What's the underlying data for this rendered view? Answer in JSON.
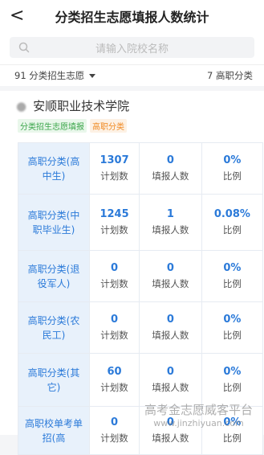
{
  "header": {
    "title": "分类招生志愿填报人数统计",
    "back_glyph": "<"
  },
  "search": {
    "placeholder": "请输入院校名称"
  },
  "filters": {
    "left": "91 分类招生志愿",
    "right": "7 高职分类"
  },
  "school": {
    "name": "安顺职业技术学院",
    "tags": [
      "分类招生志愿填报",
      "高职分类"
    ]
  },
  "columns": [
    "计划数",
    "填报人数",
    "比例"
  ],
  "rows": [
    {
      "label": "高职分类(高中生)",
      "plan": "1307",
      "applied": "0",
      "ratio": "0%"
    },
    {
      "label": "高职分类(中职毕业生)",
      "plan": "1245",
      "applied": "1",
      "ratio": "0.08%"
    },
    {
      "label": "高职分类(退役军人)",
      "plan": "0",
      "applied": "0",
      "ratio": "0%"
    },
    {
      "label": "高职分类(农民工)",
      "plan": "0",
      "applied": "0",
      "ratio": "0%"
    },
    {
      "label": "高职分类(其它)",
      "plan": "60",
      "applied": "0",
      "ratio": "0%"
    },
    {
      "label": "高职校单考单招(高",
      "plan": "0",
      "applied": "0",
      "ratio": "0%"
    }
  ],
  "watermark": {
    "line1": "高考金志愿威客平台",
    "line2": "www.jinzhiyuan.com"
  },
  "colors": {
    "accent": "#2b7ad9",
    "label_bg": "#e8f1fb",
    "tag_green": "#3aa54a",
    "tag_orange": "#f08a24"
  }
}
